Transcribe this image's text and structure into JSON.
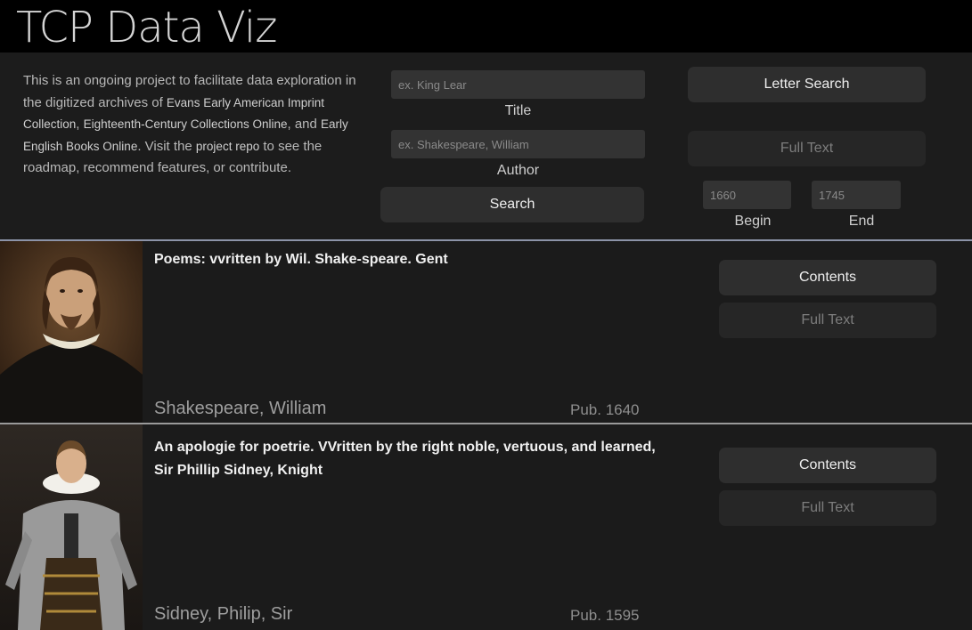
{
  "header": {
    "title": "TCP Data Viz"
  },
  "intro": {
    "t1": "This is an ongoing project to facilitate data exploration in the digitized archives of ",
    "t2": "Evans Early American Imprint Collection",
    "t3": ", ",
    "t4": "Eighteenth-Century Collections Online",
    "t5": ", and ",
    "t6": "Early English Books Online",
    "t7": ". Visit the ",
    "t8": "project repo",
    "t9": " to see the roadmap, recommend features, or contribute."
  },
  "search": {
    "title_placeholder": "ex. King Lear",
    "title_label": "Title",
    "author_placeholder": "ex. Shakespeare, William",
    "author_label": "Author",
    "search_button": "Search",
    "letter_search_button": "Letter Search",
    "full_text_button": "Full Text",
    "begin_placeholder": "1660",
    "begin_label": "Begin",
    "end_placeholder": "1745",
    "end_label": "End"
  },
  "results": [
    {
      "title": "Poems: vvritten by Wil. Shake-speare. Gent",
      "author": "Shakespeare, William",
      "pub": "Pub. 1640",
      "contents_button": "Contents",
      "full_text_button": "Full Text"
    },
    {
      "title": "An apologie for poetrie. VVritten by the right noble, vertuous, and learned, Sir Phillip Sidney, Knight",
      "author": "Sidney, Philip, Sir",
      "pub": "Pub. 1595",
      "contents_button": "Contents",
      "full_text_button": "Full Text"
    }
  ]
}
